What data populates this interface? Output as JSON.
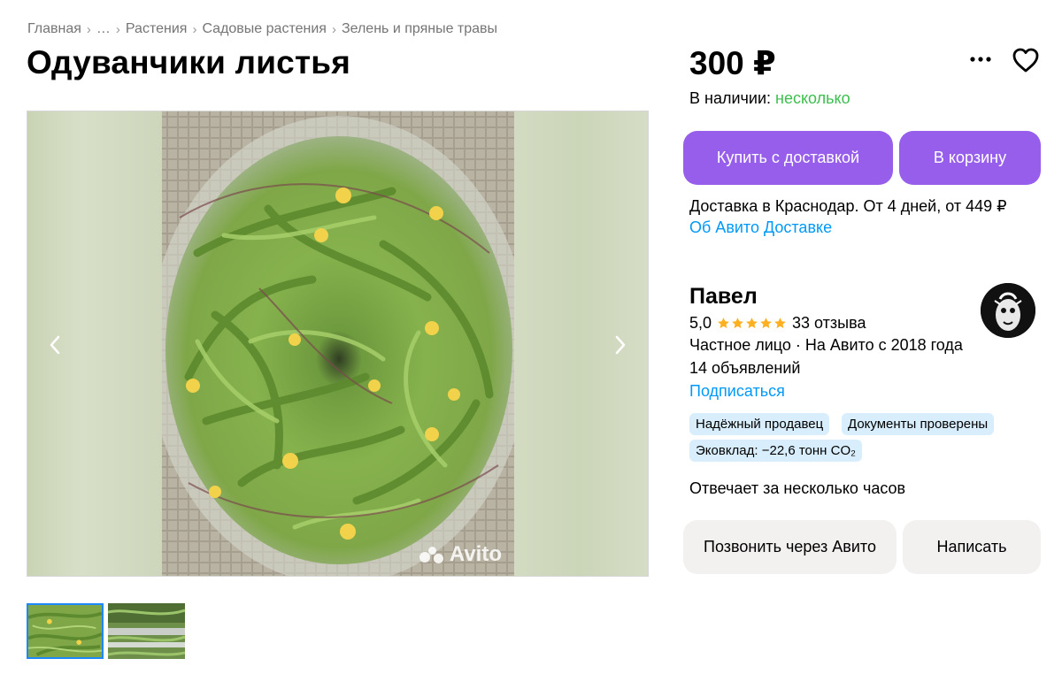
{
  "breadcrumb": {
    "items": [
      "Главная",
      "…",
      "Растения",
      "Садовые растения",
      "Зелень и пряные травы"
    ],
    "separator": "›"
  },
  "listing": {
    "title": "Одуванчики листья",
    "price": "300 ₽",
    "availability_label": "В наличии:",
    "availability_value": "несколько",
    "availability_color": "#3dbf4e"
  },
  "gallery": {
    "watermark": "Avito",
    "thumbnail_count": 2,
    "active_thumbnail": 1,
    "icons": {
      "prev": "chevron-left-icon",
      "next": "chevron-right-icon"
    }
  },
  "actions": {
    "buy_label": "Купить с доставкой",
    "cart_label": "В корзину",
    "accent_color": "#965eeb",
    "icons": {
      "more": "more-dots-icon",
      "favorite": "heart-icon"
    }
  },
  "delivery": {
    "text": "Доставка в Краснодар. От 4 дней, от 449 ₽",
    "link": "Об Авито Доставке"
  },
  "seller": {
    "name": "Павел",
    "rating": "5,0",
    "stars": 5,
    "reviews": "33 отзыва",
    "type": "Частное лицо · На Авито с 2018 года",
    "ads": "14 объявлений",
    "subscribe": "Подписаться",
    "badges": [
      "Надёжный продавец",
      "Документы проверены",
      "Эковклад: −22,6 тонн CO₂"
    ],
    "response_time": "Отвечает за несколько часов",
    "call_label": "Позвонить через Авито",
    "write_label": "Написать"
  }
}
